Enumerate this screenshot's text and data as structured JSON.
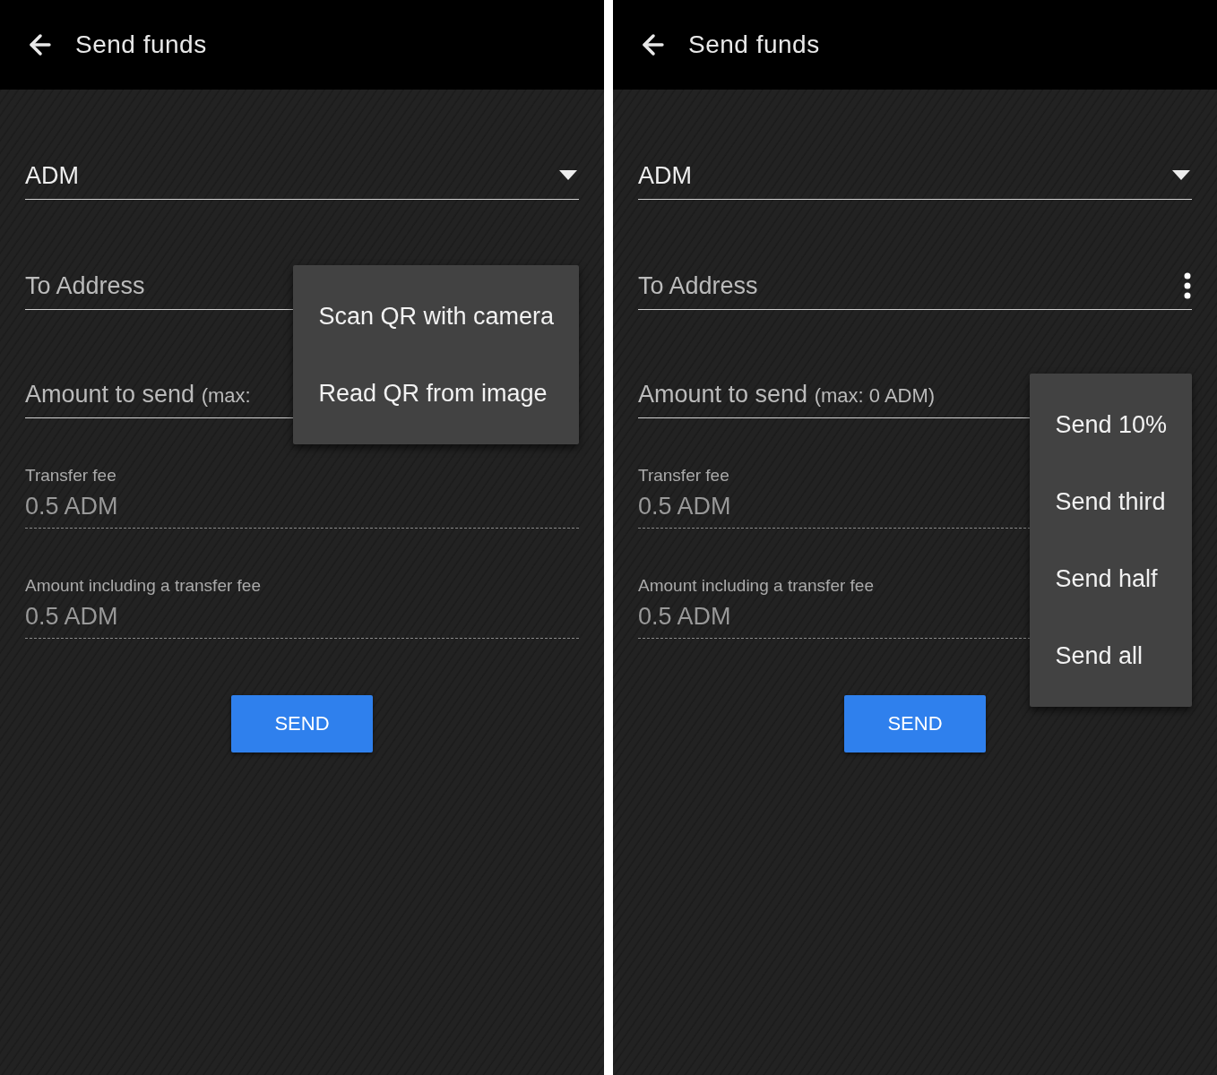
{
  "screens": [
    {
      "header": {
        "title": "Send funds"
      },
      "currency": {
        "value": "ADM"
      },
      "address": {
        "label": "To Address",
        "menu": [
          "Scan QR with camera",
          "Read QR from image"
        ]
      },
      "amount": {
        "label": "Amount to send",
        "hint": "(max:"
      },
      "fee": {
        "label": "Transfer fee",
        "value": "0.5 ADM"
      },
      "total": {
        "label": "Amount including a transfer fee",
        "value": "0.5 ADM"
      },
      "send_button": "SEND"
    },
    {
      "header": {
        "title": "Send funds"
      },
      "currency": {
        "value": "ADM"
      },
      "address": {
        "label": "To Address"
      },
      "amount": {
        "label": "Amount to send",
        "hint": "(max: 0 ADM)",
        "menu": [
          "Send 10%",
          "Send third",
          "Send half",
          "Send all"
        ]
      },
      "fee": {
        "label": "Transfer fee",
        "value": "0.5 ADM"
      },
      "total": {
        "label": "Amount including a transfer fee",
        "value": "0.5 ADM"
      },
      "send_button": "SEND"
    }
  ]
}
